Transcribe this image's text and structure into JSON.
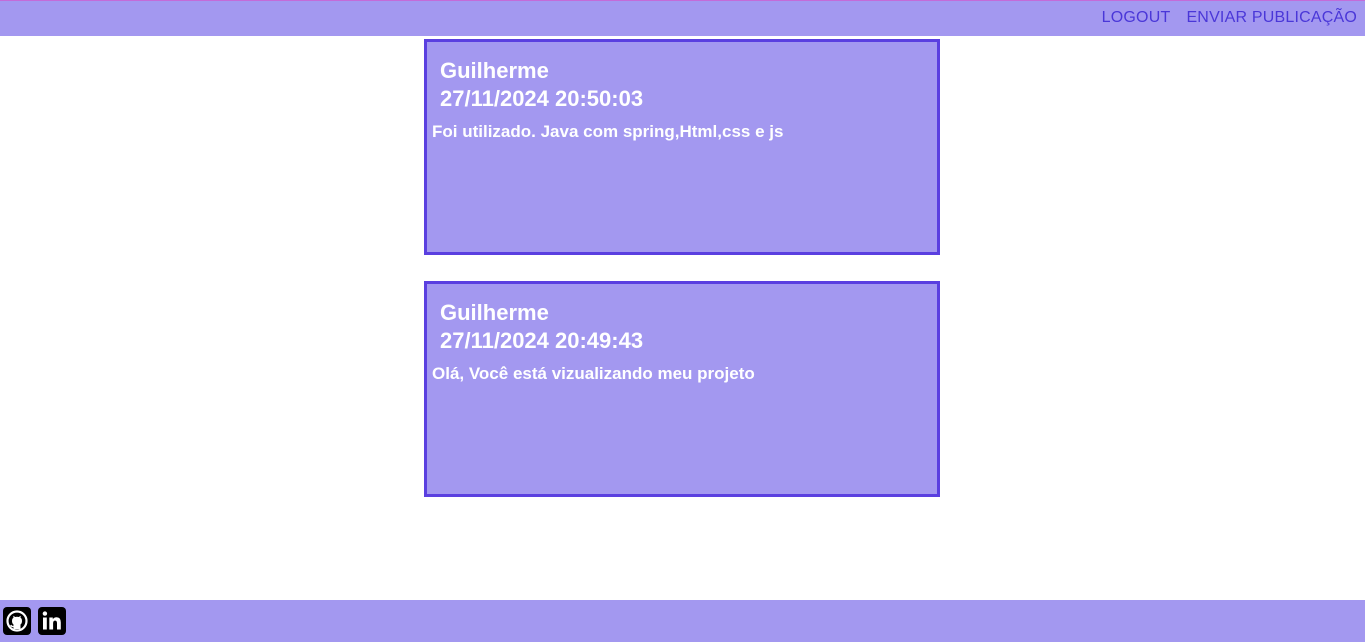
{
  "header": {
    "nav": {
      "logout_label": "LOGOUT",
      "send_post_label": "ENVIAR PUBLICAÇÃO"
    }
  },
  "posts": [
    {
      "author": "Guilherme",
      "datetime": "27/11/2024 20:50:03",
      "content": "Foi utilizado. Java com spring,Html,css e js"
    },
    {
      "author": "Guilherme",
      "datetime": "27/11/2024 20:49:43",
      "content": "Olá, Você está vizualizando meu projeto"
    }
  ],
  "footer": {
    "links": [
      {
        "icon": "github-icon"
      },
      {
        "icon": "linkedin-icon"
      }
    ]
  },
  "colors": {
    "bar_background": "#a398f0",
    "accent": "#4a37d8",
    "card_border": "#5a3fe0"
  }
}
